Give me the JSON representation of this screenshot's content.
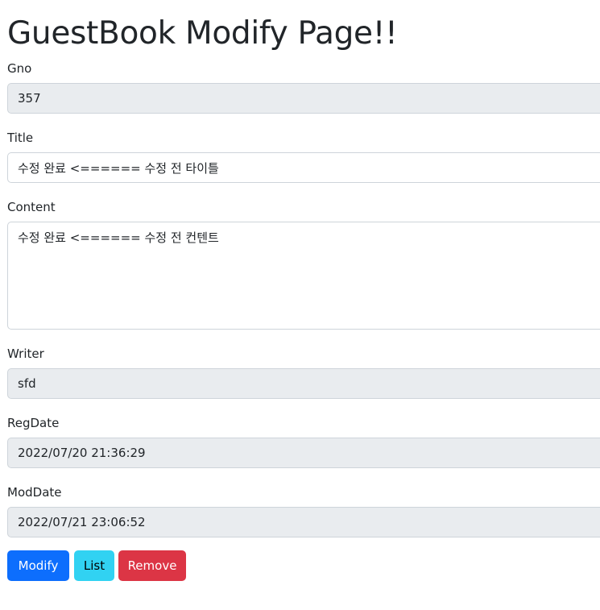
{
  "page": {
    "title": "GuestBook Modify Page!!"
  },
  "fields": {
    "gno": {
      "label": "Gno",
      "value": "357"
    },
    "title": {
      "label": "Title",
      "value": "수정 완료 <====== 수정 전 타이틀"
    },
    "content": {
      "label": "Content",
      "value": "수정 완료 <====== 수정 전 컨텐트"
    },
    "writer": {
      "label": "Writer",
      "value": "sfd"
    },
    "regdate": {
      "label": "RegDate",
      "value": "2022/07/20 21:36:29"
    },
    "moddate": {
      "label": "ModDate",
      "value": "2022/07/21 23:06:52"
    }
  },
  "buttons": {
    "modify": "Modify",
    "list": "List",
    "remove": "Remove"
  },
  "colors": {
    "primary": "#0d6efd",
    "info": "#31d2f2",
    "danger": "#dc3545",
    "readonly_bg": "#e9ecef",
    "border": "#ced4da"
  }
}
